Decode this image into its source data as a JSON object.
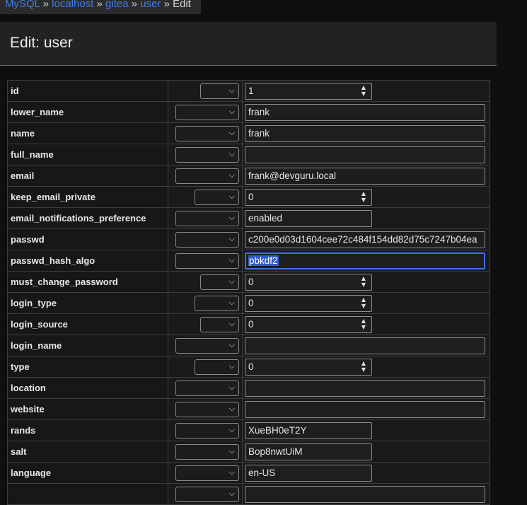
{
  "breadcrumb": {
    "items": [
      "MySQL",
      "localhost",
      "gitea",
      "user"
    ],
    "separator": "»",
    "current": "Edit"
  },
  "header": {
    "title": "Edit: user"
  },
  "rows": [
    {
      "name": "id",
      "value": "1"
    },
    {
      "name": "lower_name",
      "value": "frank"
    },
    {
      "name": "name",
      "value": "frank"
    },
    {
      "name": "full_name",
      "value": ""
    },
    {
      "name": "email",
      "value": "frank@devguru.local"
    },
    {
      "name": "keep_email_private",
      "value": "0"
    },
    {
      "name": "email_notifications_preference",
      "value": "enabled"
    },
    {
      "name": "passwd",
      "value": "c200e0d03d1604cee72c484f154dd82d75c7247b04ea"
    },
    {
      "name": "passwd_hash_algo",
      "value": "pbkdf2"
    },
    {
      "name": "must_change_password",
      "value": "0"
    },
    {
      "name": "login_type",
      "value": "0"
    },
    {
      "name": "login_source",
      "value": "0"
    },
    {
      "name": "login_name",
      "value": ""
    },
    {
      "name": "type",
      "value": "0"
    },
    {
      "name": "location",
      "value": ""
    },
    {
      "name": "website",
      "value": ""
    },
    {
      "name": "rands",
      "value": "XueBH0eT2Y"
    },
    {
      "name": "salt",
      "value": "Bop8nwtUiM"
    },
    {
      "name": "language",
      "value": "en-US"
    }
  ],
  "icons": {
    "select": "chevron-down-icon",
    "spinner": "spinner-arrows-icon"
  },
  "colors": {
    "link": "#3f7ee8",
    "focus": "#3d6ff0",
    "selection": "#2f5bc9"
  }
}
